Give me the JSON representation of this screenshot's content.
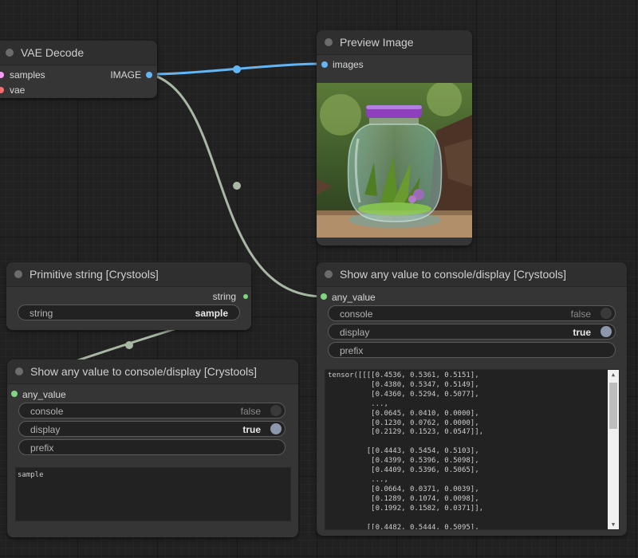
{
  "vae_decode": {
    "title": "VAE Decode",
    "inputs": [
      "samples",
      "vae"
    ],
    "output": "IMAGE"
  },
  "preview_image": {
    "title": "Preview Image",
    "input": "images"
  },
  "primitive_string": {
    "title": "Primitive string [Crystools]",
    "output": "string",
    "widget_label": "string",
    "widget_value": "sample"
  },
  "show_any_left": {
    "title": "Show any value to console/display [Crystools]",
    "input": "any_value",
    "console_label": "console",
    "console_value": "false",
    "display_label": "display",
    "display_value": "true",
    "prefix_label": "prefix",
    "text": "sample"
  },
  "show_any_right": {
    "title": "Show any value to console/display [Crystools]",
    "input": "any_value",
    "console_label": "console",
    "console_value": "false",
    "display_label": "display",
    "display_value": "true",
    "prefix_label": "prefix",
    "text": "tensor([[[[0.4536, 0.5361, 0.5151],\n          [0.4380, 0.5347, 0.5149],\n          [0.4360, 0.5294, 0.5077],\n          ...,\n          [0.0645, 0.0410, 0.0000],\n          [0.1230, 0.0762, 0.0000],\n          [0.2129, 0.1523, 0.0547]],\n\n         [[0.4443, 0.5454, 0.5103],\n          [0.4399, 0.5396, 0.5098],\n          [0.4409, 0.5396, 0.5065],\n          ...,\n          [0.0664, 0.0371, 0.0039],\n          [0.1289, 0.1074, 0.0098],\n          [0.1992, 0.1582, 0.0371]],\n\n         [[0.4482, 0.5444, 0.5095],"
  },
  "colors": {
    "canvas": "#212121",
    "node_body": "#353535",
    "node_header": "#2f2f2f",
    "image_link": "#64b5f6",
    "any_link": "#a8b8a4",
    "string_slot": "#7fd87f",
    "latent_slot": "#ff9cf9",
    "vae_slot": "#ff6e6e"
  },
  "icons": {
    "scroll_up": "▲",
    "scroll_down": "▼"
  }
}
